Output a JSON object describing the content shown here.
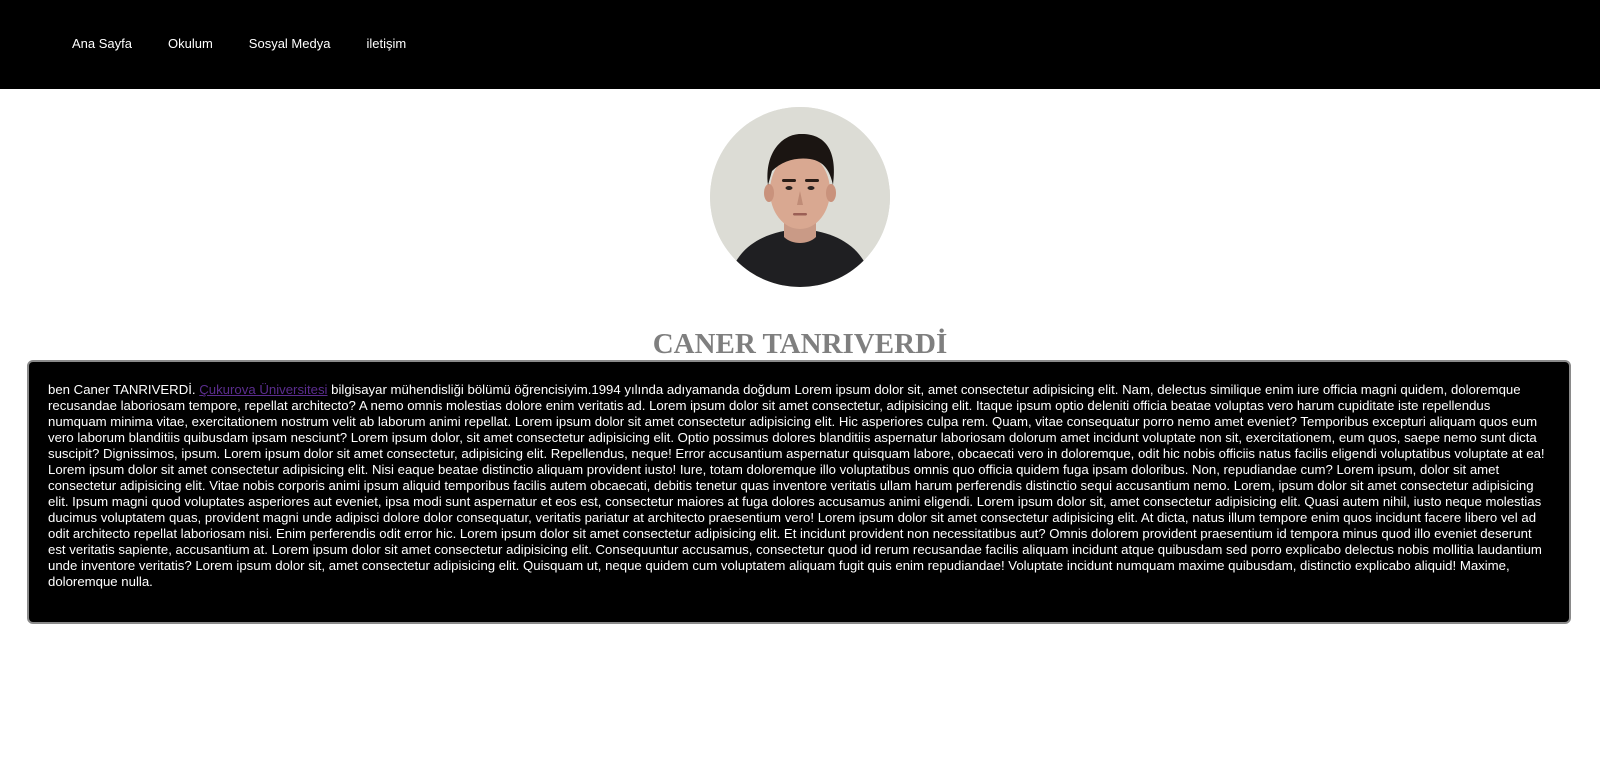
{
  "nav": {
    "items": [
      {
        "label": "Ana Sayfa"
      },
      {
        "label": "Okulum"
      },
      {
        "label": "Sosyal Medya"
      },
      {
        "label": "iletişim"
      }
    ]
  },
  "profile": {
    "photo_icon": "person-portrait",
    "name": "CANER TANRIVERDİ"
  },
  "bio": {
    "intro": "ben Caner TANRIVERDİ.",
    "link_text": "Çukurova Üniversitesi",
    "text": "bilgisayar mühendisliği bölümü öğrencisiyim.1994 yılında adıyamanda doğdum Lorem ipsum dolor sit, amet consectetur adipisicing elit. Nam, delectus similique enim iure officia magni quidem, doloremque recusandae laboriosam tempore, repellat architecto? A nemo omnis molestias dolore enim veritatis ad. Lorem ipsum dolor sit amet consectetur, adipisicing elit. Itaque ipsum optio deleniti officia beatae voluptas vero harum cupiditate iste repellendus numquam minima vitae, exercitationem nostrum velit ab laborum animi repellat. Lorem ipsum dolor sit amet consectetur adipisicing elit. Hic asperiores culpa rem. Quam, vitae consequatur porro nemo amet eveniet? Temporibus excepturi aliquam quos eum vero laborum blanditiis quibusdam ipsam nesciunt? Lorem ipsum dolor, sit amet consectetur adipisicing elit. Optio possimus dolores blanditiis aspernatur laboriosam dolorum amet incidunt voluptate non sit, exercitationem, eum quos, saepe nemo sunt dicta suscipit? Dignissimos, ipsum. Lorem ipsum dolor sit amet consectetur, adipisicing elit. Repellendus, neque! Error accusantium aspernatur quisquam labore, obcaecati vero in doloremque, odit hic nobis officiis natus facilis eligendi voluptatibus voluptate at ea! Lorem ipsum dolor sit amet consectetur adipisicing elit. Nisi eaque beatae distinctio aliquam provident iusto! Iure, totam doloremque illo voluptatibus omnis quo officia quidem fuga ipsam doloribus. Non, repudiandae cum? Lorem ipsum, dolor sit amet consectetur adipisicing elit. Vitae nobis corporis animi ipsum aliquid temporibus facilis autem obcaecati, debitis tenetur quas inventore veritatis ullam harum perferendis distinctio sequi accusantium nemo. Lorem, ipsum dolor sit amet consectetur adipisicing elit. Ipsum magni quod voluptates asperiores aut eveniet, ipsa modi sunt aspernatur et eos est, consectetur maiores at fuga dolores accusamus animi eligendi. Lorem ipsum dolor sit, amet consectetur adipisicing elit. Quasi autem nihil, iusto neque molestias ducimus voluptatem quas, provident magni unde adipisci dolore dolor consequatur, veritatis pariatur at architecto praesentium vero! Lorem ipsum dolor sit amet consectetur adipisicing elit. At dicta, natus illum tempore enim quos incidunt facere libero vel ad odit architecto repellat laboriosam nisi. Enim perferendis odit error hic. Lorem ipsum dolor sit amet consectetur adipisicing elit. Et incidunt provident non necessitatibus aut? Omnis dolorem provident praesentium id tempora minus quod illo eveniet deserunt est veritatis sapiente, accusantium at. Lorem ipsum dolor sit amet consectetur adipisicing elit. Consequuntur accusamus, consectetur quod id rerum recusandae facilis aliquam incidunt atque quibusdam sed porro explicabo delectus nobis mollitia laudantium unde inventore veritatis? Lorem ipsum dolor sit, amet consectetur adipisicing elit. Quisquam ut, neque quidem cum voluptatem aliquam fugit quis enim repudiandae! Voluptate incidunt numquam maxime quibusdam, distinctio explicabo aliquid! Maxime, doloremque nulla."
  },
  "colors": {
    "nav_background": "#000000",
    "nav_text": "#ffffff",
    "heading": "#7f7f7f",
    "bio_background": "#000000",
    "bio_border": "#8a8a8a",
    "link_visited": "#5b2d8e"
  }
}
